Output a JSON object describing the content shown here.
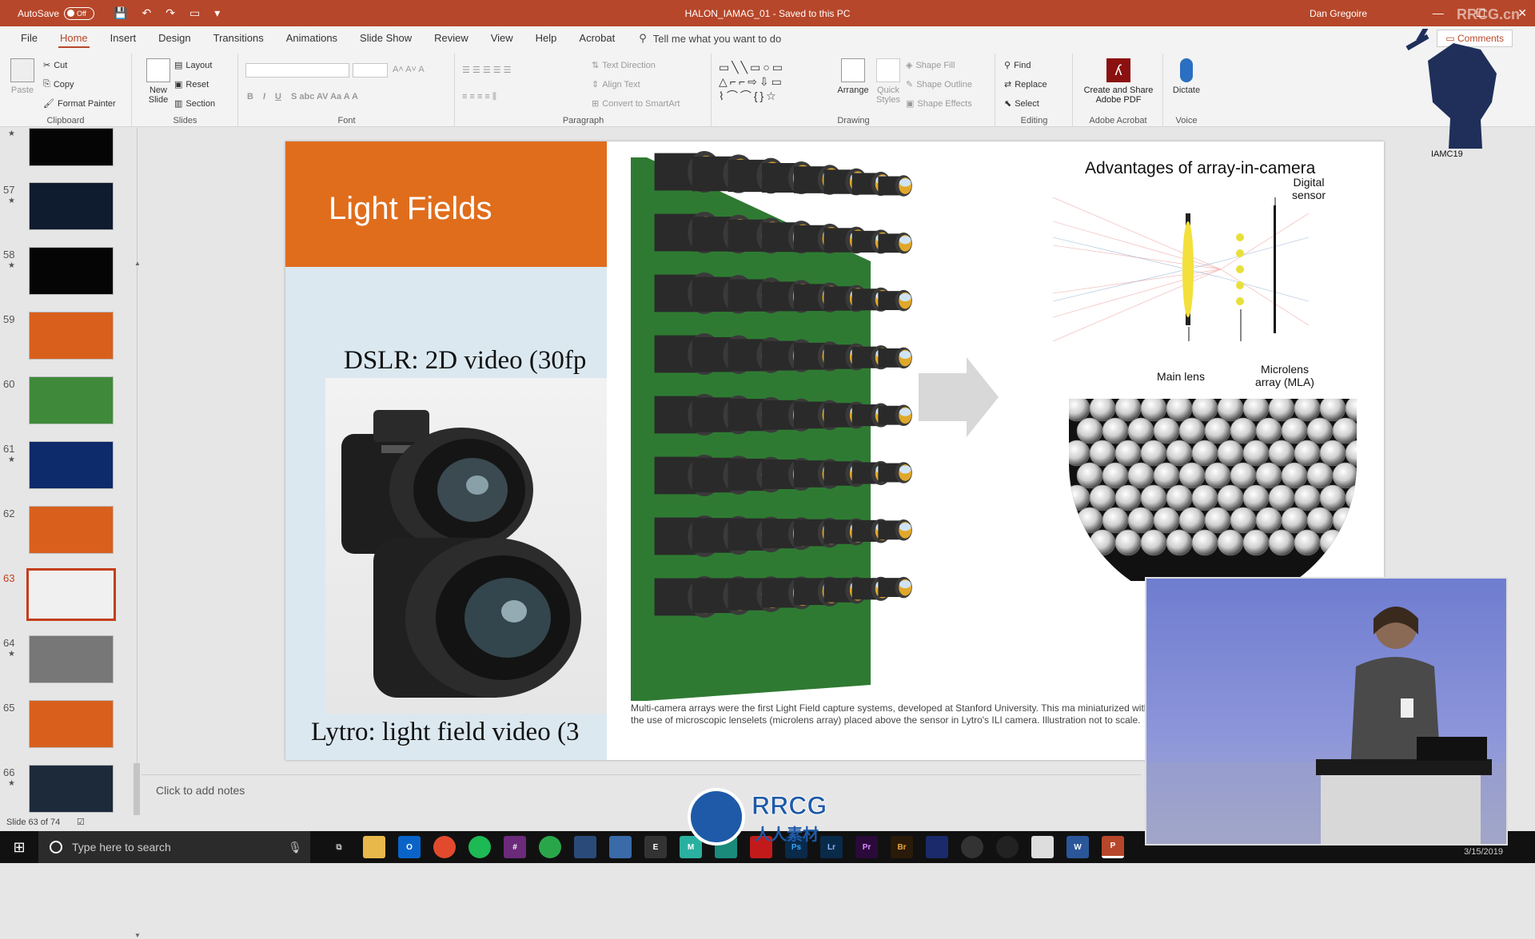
{
  "window": {
    "autosave_label": "AutoSave",
    "autosave_state": "Off",
    "title": "HALON_IAMAG_01 - Saved to this PC",
    "user": "Dan Gregoire"
  },
  "tabs": [
    "File",
    "Home",
    "Insert",
    "Design",
    "Transitions",
    "Animations",
    "Slide Show",
    "Review",
    "View",
    "Help",
    "Acrobat"
  ],
  "active_tab": "Home",
  "tell_me": "Tell me what you want to do",
  "comments_label": "Comments",
  "ribbon": {
    "clipboard": {
      "paste": "Paste",
      "cut": "Cut",
      "copy": "Copy",
      "format_painter": "Format Painter",
      "label": "Clipboard"
    },
    "slides": {
      "new_slide_1": "New",
      "new_slide_2": "Slide",
      "layout": "Layout",
      "reset": "Reset",
      "section": "Section",
      "label": "Slides"
    },
    "font": {
      "label": "Font"
    },
    "paragraph": {
      "text_direction": "Text Direction",
      "align_text": "Align Text",
      "convert_smartart": "Convert to SmartArt",
      "label": "Paragraph"
    },
    "drawing": {
      "arrange": "Arrange",
      "quick_styles_1": "Quick",
      "quick_styles_2": "Styles",
      "shape_fill": "Shape Fill",
      "shape_outline": "Shape Outline",
      "shape_effects": "Shape Effects",
      "label": "Drawing"
    },
    "editing": {
      "find": "Find",
      "replace": "Replace",
      "select": "Select",
      "label": "Editing"
    },
    "acrobat": {
      "create_1": "Create and Share",
      "create_2": "Adobe PDF",
      "label": "Adobe Acrobat"
    },
    "voice": {
      "dictate": "Dictate",
      "label": "Voice"
    }
  },
  "thumbnails": [
    {
      "num": "57",
      "star": "★",
      "color": "#0f1b2e"
    },
    {
      "num": "58",
      "star": "★",
      "color": "#050505"
    },
    {
      "num": "59",
      "star": "",
      "color": "#d9601c"
    },
    {
      "num": "60",
      "star": "",
      "color": "#3f8a3a"
    },
    {
      "num": "61",
      "star": "★",
      "color": "#0d2a6a"
    },
    {
      "num": "62",
      "star": "",
      "color": "#d9601c"
    },
    {
      "num": "63",
      "star": "",
      "color": "#f0f0f0"
    },
    {
      "num": "64",
      "star": "★",
      "color": "#777777"
    },
    {
      "num": "65",
      "star": "",
      "color": "#d9601c"
    },
    {
      "num": "66",
      "star": "★",
      "color": "#1c2a3a"
    }
  ],
  "slide": {
    "title": "Light Fields",
    "dslr": "DSLR: 2D video (30fp",
    "lytro": "Lytro: light field video (3",
    "adv_title": "Advantages of array-in-camera",
    "label_digital": "Digital",
    "label_sensor": "sensor",
    "label_main_lens": "Main lens",
    "label_microlens_1": "Microlens",
    "label_microlens_2": "array (MLA)",
    "caption": "Multi-camera arrays were the first Light Field capture systems, developed at Stanford University. This ma miniaturized with the use of microscopic lenselets (microlens array) placed above the sensor in Lytro's ILI camera. Illustration not to scale."
  },
  "notes_placeholder": "Click to add notes",
  "status": {
    "slide_count": "Slide 63 of 74"
  },
  "taskbar": {
    "search_placeholder": "Type here to search",
    "date": "3/15/2019"
  },
  "overlay": {
    "badge": "IAMC19",
    "watermark_main": "RRCG",
    "watermark_sub": "人人素材",
    "corner_watermark": "RRCG.cn"
  },
  "colors": {
    "accent": "#b7472a",
    "slide_orange": "#e06d1c",
    "selected_thumb": "#c43e1c"
  }
}
